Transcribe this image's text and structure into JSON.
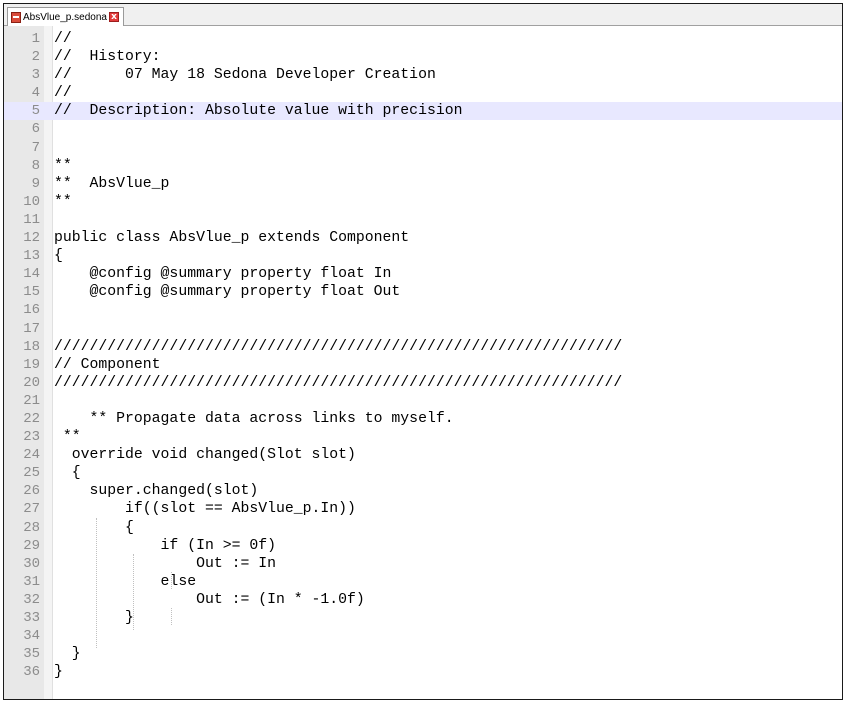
{
  "tab": {
    "filename": "AbsVlue_p.sedona",
    "close_label": "x"
  },
  "editor": {
    "highlight_line": 5,
    "lines": [
      {
        "n": "1",
        "t": "//"
      },
      {
        "n": "2",
        "t": "//  History:"
      },
      {
        "n": "3",
        "t": "//      07 May 18 Sedona Developer Creation"
      },
      {
        "n": "4",
        "t": "//"
      },
      {
        "n": "5",
        "t": "//  Description: Absolute value with precision"
      },
      {
        "n": "6",
        "t": ""
      },
      {
        "n": "7",
        "t": ""
      },
      {
        "n": "8",
        "t": "**"
      },
      {
        "n": "9",
        "t": "**  AbsVlue_p"
      },
      {
        "n": "10",
        "t": "**"
      },
      {
        "n": "11",
        "t": ""
      },
      {
        "n": "12",
        "t": "public class AbsVlue_p extends Component"
      },
      {
        "n": "13",
        "t": "{"
      },
      {
        "n": "14",
        "t": "    @config @summary property float In"
      },
      {
        "n": "15",
        "t": "    @config @summary property float Out"
      },
      {
        "n": "16",
        "t": ""
      },
      {
        "n": "17",
        "t": ""
      },
      {
        "n": "18",
        "t": "////////////////////////////////////////////////////////////////"
      },
      {
        "n": "19",
        "t": "// Component"
      },
      {
        "n": "20",
        "t": "////////////////////////////////////////////////////////////////"
      },
      {
        "n": "21",
        "t": ""
      },
      {
        "n": "22",
        "t": "    ** Propagate data across links to myself."
      },
      {
        "n": "23",
        "t": " **"
      },
      {
        "n": "24",
        "t": "  override void changed(Slot slot)"
      },
      {
        "n": "25",
        "t": "  {"
      },
      {
        "n": "26",
        "t": "    super.changed(slot)"
      },
      {
        "n": "27",
        "t": "        if((slot == AbsVlue_p.In))"
      },
      {
        "n": "28",
        "t": "        {"
      },
      {
        "n": "29",
        "t": "            if (In >= 0f)"
      },
      {
        "n": "30",
        "t": "                Out := In"
      },
      {
        "n": "31",
        "t": "            else"
      },
      {
        "n": "32",
        "t": "                Out := (In * -1.0f)"
      },
      {
        "n": "33",
        "t": "        }"
      },
      {
        "n": "34",
        "t": ""
      },
      {
        "n": "35",
        "t": "  }"
      },
      {
        "n": "36",
        "t": "}"
      }
    ]
  }
}
